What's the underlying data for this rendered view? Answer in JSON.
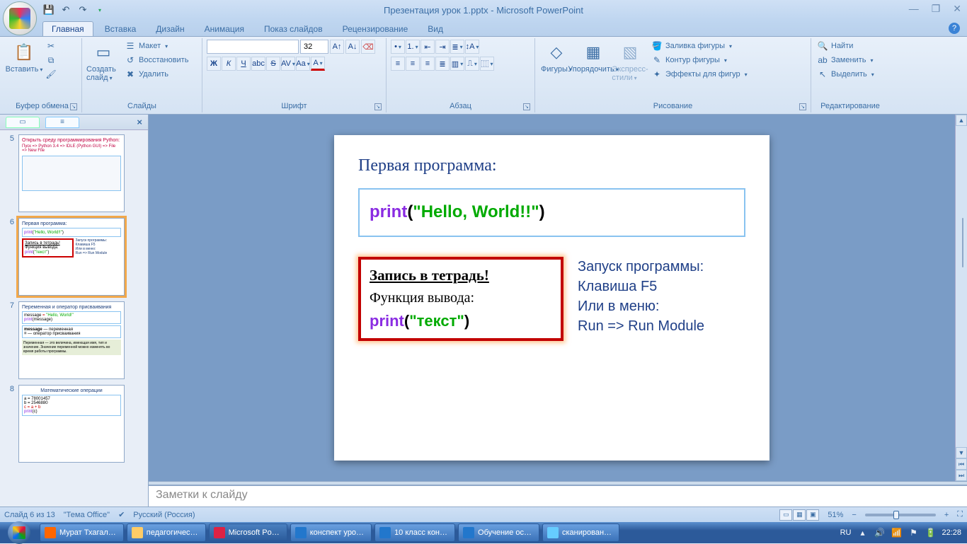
{
  "titlebar": {
    "document": "Презентация урок 1.pptx",
    "app": "Microsoft PowerPoint"
  },
  "tabs": [
    "Главная",
    "Вставка",
    "Дизайн",
    "Анимация",
    "Показ слайдов",
    "Рецензирование",
    "Вид"
  ],
  "ribbon": {
    "clipboard": {
      "paste": "Вставить",
      "label": "Буфер обмена"
    },
    "slides": {
      "new": "Создать слайд",
      "layout": "Макет",
      "reset": "Восстановить",
      "delete": "Удалить",
      "label": "Слайды"
    },
    "font": {
      "size": "32",
      "label": "Шрифт"
    },
    "paragraph": {
      "label": "Абзац"
    },
    "drawing": {
      "shapes": "Фигуры",
      "arrange": "Упорядочить",
      "styles": "Экспресс-стили",
      "fill": "Заливка фигуры",
      "outline": "Контур фигуры",
      "effects": "Эффекты для фигур",
      "label": "Рисование"
    },
    "editing": {
      "find": "Найти",
      "replace": "Заменить",
      "select": "Выделить",
      "label": "Редактирование"
    }
  },
  "thumbs": {
    "t5": {
      "num": "5",
      "title": "Открыть среду программирования Python:",
      "line1": "Пуск  =>  Python 3.4  =>  IDLE (Python GUI)  =>  File  =>  New File"
    },
    "t6": {
      "num": "6",
      "title": "Первая программа:",
      "code1_kw": "print",
      "code1_par1": "(",
      "code1_str": "\"Hello, World!!\"",
      "code1_par2": ")",
      "red_h": "Запись в тетрадь!",
      "red_l": "Функция вывода:",
      "red_kw": "print",
      "red_p1": "(",
      "red_str": "\"текст\"",
      "red_p2": ")",
      "right": "Запуск программы:\nКлавиша F5\nИли в меню:\nRun  =>  Run Module"
    },
    "t7": {
      "num": "7",
      "title": "Переменная и оператор присваивания",
      "l1": "message = \"Hello, World!\"",
      "l2": "print(message)",
      "l3": "message — переменная",
      "l4": "= — оператор присваивания",
      "l5": "Переменная — это величина, имеющая имя, тип и значение. Значение переменной можно изменять во время работы программы."
    },
    "t8": {
      "num": "8",
      "title": "Математические операции",
      "c1": "a = 78001457",
      "c2": "b = 2546880",
      "c3": "c = a + b",
      "c4": "print(c)"
    }
  },
  "slide": {
    "title": "Первая программа:",
    "code1_kw": "print",
    "code1_par1": "(",
    "code1_str": "\"Hello, World!!\"",
    "code1_par2": ")",
    "red_h": "Запись в тетрадь!",
    "red_l": "Функция вывода:",
    "red_kw": "print",
    "red_p1": "(",
    "red_str": "\"текст\"",
    "red_p2": ")",
    "right1": "Запуск программы:",
    "right2": "Клавиша F5",
    "right3": "Или в меню:",
    "right4": "Run   =>  Run Module"
  },
  "notes": {
    "placeholder": "Заметки к слайду"
  },
  "status": {
    "pos": "Слайд 6 из 13",
    "theme": "\"Тема Office\"",
    "lang": "Русский (Россия)",
    "zoom": "51%"
  },
  "taskbar": {
    "items": [
      {
        "label": "Мурат Тхагал…"
      },
      {
        "label": "педагогичес…"
      },
      {
        "label": "Microsoft Po…"
      },
      {
        "label": "конспект уро…"
      },
      {
        "label": "10 класс кон…"
      },
      {
        "label": "Обучение ос…"
      },
      {
        "label": "сканирован…"
      }
    ],
    "lang": "RU",
    "time": "22:28"
  }
}
